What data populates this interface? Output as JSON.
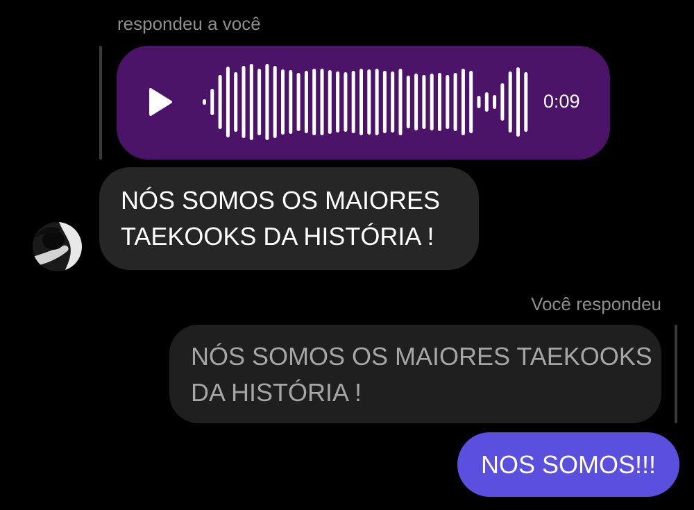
{
  "incoming_reply": {
    "caption": "respondeu a você",
    "voice_message": {
      "duration": "0:09",
      "play_icon": "play-icon"
    }
  },
  "incoming_message": {
    "lines": [
      "NÓS SOMOS OS MAIORES",
      "TAEKOOKS DA HISTÓRIA !"
    ],
    "avatar": "profile-photo"
  },
  "outgoing_reply": {
    "caption": "Você respondeu",
    "quoted_lines": [
      "NÓS SOMOS OS MAIORES TAEKOOKS",
      "DA HISTÓRIA !"
    ]
  },
  "outgoing_message": {
    "text": "NOS SOMOS!!!"
  },
  "colors": {
    "background": "#000000",
    "voice_bubble": "#4b1469",
    "incoming_bubble": "#262626",
    "quoted_bubble": "#1f1f1f",
    "own_bubble": "#5b4fe0"
  }
}
